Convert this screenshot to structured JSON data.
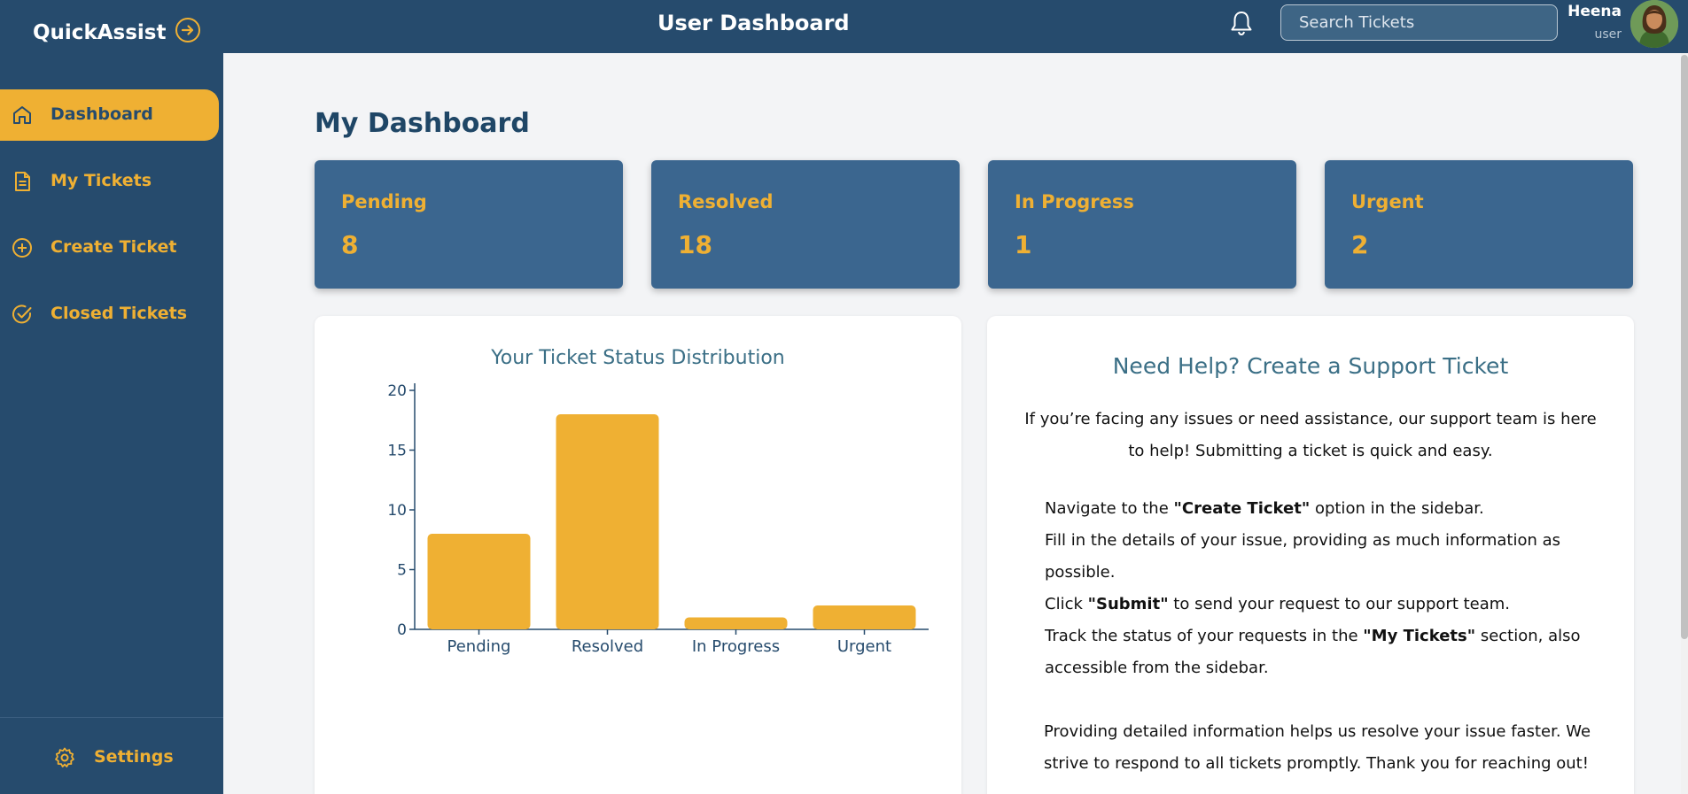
{
  "app": {
    "brand": "QuickAssist",
    "page_heading": "User Dashboard"
  },
  "search": {
    "placeholder": "Search Tickets",
    "value": ""
  },
  "user": {
    "name": "Heena",
    "role": "user"
  },
  "sidebar": {
    "items": [
      {
        "label": "Dashboard",
        "icon": "home-icon",
        "active": true
      },
      {
        "label": "My Tickets",
        "icon": "document-icon",
        "active": false
      },
      {
        "label": "Create Ticket",
        "icon": "plus-circle-icon",
        "active": false
      },
      {
        "label": "Closed Tickets",
        "icon": "check-circle-icon",
        "active": false
      }
    ],
    "settings_label": "Settings"
  },
  "main": {
    "title": "My Dashboard"
  },
  "stats": [
    {
      "label": "Pending",
      "value": "8"
    },
    {
      "label": "Resolved",
      "value": "18"
    },
    {
      "label": "In Progress",
      "value": "1"
    },
    {
      "label": "Urgent",
      "value": "2"
    }
  ],
  "chart_data": {
    "type": "bar",
    "title": "Your Ticket Status Distribution",
    "categories": [
      "Pending",
      "Resolved",
      "In Progress",
      "Urgent"
    ],
    "values": [
      8,
      18,
      1,
      2
    ],
    "ylim": [
      0,
      20
    ],
    "yticks": [
      0,
      5,
      10,
      15,
      20
    ],
    "xlabel": "",
    "ylabel": "",
    "grid": false,
    "color": "#efb033"
  },
  "help": {
    "title": "Need Help? Create a Support Ticket",
    "intro": "If you’re facing any issues or need assistance, our support team is here to help! Submitting a ticket is quick and easy.",
    "steps": [
      {
        "pre": "Navigate to the ",
        "bold": "\"Create Ticket\"",
        "post": " option in the sidebar."
      },
      {
        "pre": "Fill in the details of your issue, providing as much information as possible.",
        "bold": "",
        "post": ""
      },
      {
        "pre": "Click ",
        "bold": "\"Submit\"",
        "post": " to send your request to our support team."
      },
      {
        "pre": "Track the status of your requests in the ",
        "bold": "\"My Tickets\"",
        "post": " section, also accessible from the sidebar."
      }
    ],
    "outro": "Providing detailed information helps us resolve your issue faster. We strive to respond to all tickets promptly. Thank you for reaching out!"
  },
  "colors": {
    "navy": "#264b6d",
    "accent": "#efb033",
    "card": "#3b668f",
    "title_teal": "#3b6f86"
  }
}
